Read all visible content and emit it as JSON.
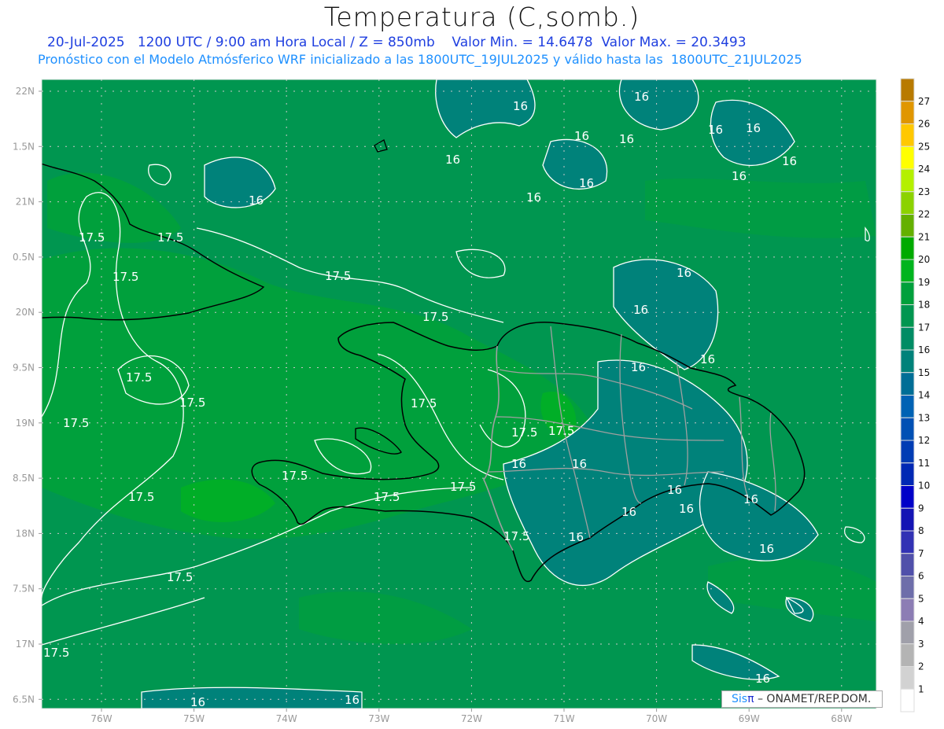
{
  "title": "Temperatura (C,somb.)",
  "subtitle_line1": "20-Jul-2025   1200 UTC / 9:00 am Hora Local / Z = 850mb    Valor Min. = 14.6478  Valor Max. = 20.3493",
  "subtitle_line2": "Pronóstico con el Modelo Atmósferico WRF inicializado a las 1800UTC_19JUL2025 y válido hasta las  1800UTC_21JUL2025",
  "lat_labels": [
    "22N",
    "1.5N",
    "21N",
    "0.5N",
    "20N",
    "9.5N",
    "19N",
    "8.5N",
    "18N",
    "7.5N",
    "17N",
    "6.5N"
  ],
  "lon_labels": [
    "76W",
    "75W",
    "74W",
    "73W",
    "72W",
    "71W",
    "70W",
    "69W",
    "68W"
  ],
  "contour_levels": [
    "16",
    "17.5"
  ],
  "colorbar": {
    "labels": [
      "27",
      "26",
      "25",
      "24",
      "23",
      "22",
      "21",
      "20",
      "19",
      "18",
      "17",
      "16",
      "15",
      "14",
      "13",
      "12",
      "11",
      "10",
      "9",
      "8",
      "7",
      "6",
      "5",
      "4",
      "3",
      "2",
      "1"
    ],
    "colors": [
      "#b87a00",
      "#e09600",
      "#ffc800",
      "#ffff00",
      "#b4f000",
      "#8cd200",
      "#64b000",
      "#00aa00",
      "#00b41e",
      "#00a03c",
      "#009650",
      "#008c64",
      "#00827a",
      "#006e96",
      "#0062b4",
      "#0050b4",
      "#003cb4",
      "#0028b4",
      "#0000c8",
      "#1414b4",
      "#3232b4",
      "#5050aa",
      "#6e6eaa",
      "#8c7db4",
      "#a0a0aa",
      "#b4b4b4",
      "#d2d2d2",
      "#ffffff"
    ]
  },
  "logo": {
    "sis": "Sis",
    "pi": "π",
    "text": "– ONAMET/REP.DOM."
  },
  "colors": {
    "land_outline": "#000000",
    "province_lines": "#a0a0a0",
    "contours": "#ffffff",
    "grid": "#c8c8c8"
  }
}
